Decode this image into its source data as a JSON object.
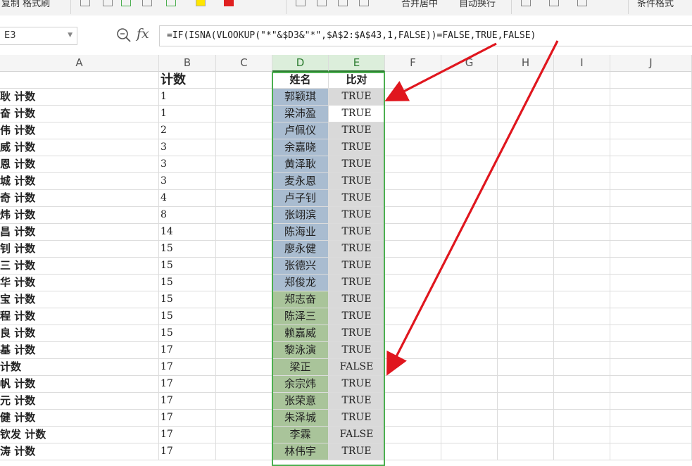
{
  "toolbar": {
    "items": [
      "复制 格式刷",
      "合并居中",
      "自动换行",
      "条件格式"
    ]
  },
  "formula_bar": {
    "name_box": "E3",
    "fx_label": "fx",
    "formula": "=IF(ISNA(VLOOKUP(\"*\"&$D3&\"*\",$A$2:$A$43,1,FALSE))=FALSE,TRUE,FALSE)"
  },
  "columns": [
    "A",
    "B",
    "C",
    "D",
    "E",
    "F",
    "G",
    "H",
    "I",
    "J"
  ],
  "header_row": {
    "b": "计数",
    "d": "姓名",
    "e": "比对"
  },
  "rows": [
    {
      "a": "耿 计数",
      "b": "1",
      "d": "郭颖琪",
      "e": "TRUE",
      "group": "blue"
    },
    {
      "a": "奋 计数",
      "b": "1",
      "d": "梁沛盈",
      "e": "TRUE",
      "group": "blue"
    },
    {
      "a": "伟 计数",
      "b": "2",
      "d": "卢佩仪",
      "e": "TRUE",
      "group": "blue"
    },
    {
      "a": "威 计数",
      "b": "3",
      "d": "余嘉晓",
      "e": "TRUE",
      "group": "blue"
    },
    {
      "a": "恩 计数",
      "b": "3",
      "d": "黄泽耿",
      "e": "TRUE",
      "group": "blue"
    },
    {
      "a": "城 计数",
      "b": "3",
      "d": "麦永恩",
      "e": "TRUE",
      "group": "blue"
    },
    {
      "a": "奇 计数",
      "b": "4",
      "d": "卢子钊",
      "e": "TRUE",
      "group": "blue"
    },
    {
      "a": "炜 计数",
      "b": "8",
      "d": "张翊滨",
      "e": "TRUE",
      "group": "blue"
    },
    {
      "a": "昌 计数",
      "b": "14",
      "d": "陈海业",
      "e": "TRUE",
      "group": "blue"
    },
    {
      "a": "钊 计数",
      "b": "15",
      "d": "廖永健",
      "e": "TRUE",
      "group": "blue"
    },
    {
      "a": "三 计数",
      "b": "15",
      "d": "张德兴",
      "e": "TRUE",
      "group": "blue"
    },
    {
      "a": "华 计数",
      "b": "15",
      "d": "郑俊龙",
      "e": "TRUE",
      "group": "blue"
    },
    {
      "a": "宝 计数",
      "b": "15",
      "d": "郑志奋",
      "e": "TRUE",
      "group": "green"
    },
    {
      "a": "程 计数",
      "b": "15",
      "d": "陈泽三",
      "e": "TRUE",
      "group": "green"
    },
    {
      "a": "良 计数",
      "b": "15",
      "d": "赖嘉威",
      "e": "TRUE",
      "group": "green"
    },
    {
      "a": "基 计数",
      "b": "17",
      "d": "黎泳演",
      "e": "TRUE",
      "group": "green"
    },
    {
      "a": " 计数",
      "b": "17",
      "d": "梁正",
      "e": "FALSE",
      "group": "green"
    },
    {
      "a": "帆 计数",
      "b": "17",
      "d": "余宗炜",
      "e": "TRUE",
      "group": "green"
    },
    {
      "a": "元 计数",
      "b": "17",
      "d": "张荣意",
      "e": "TRUE",
      "group": "green"
    },
    {
      "a": "健 计数",
      "b": "17",
      "d": "朱泽城",
      "e": "TRUE",
      "group": "green"
    },
    {
      "a": "钦发 计数",
      "b": "17",
      "d": "李霖",
      "e": "FALSE",
      "group": "green"
    },
    {
      "a": "涛 计数",
      "b": "17",
      "d": "林伟宇",
      "e": "TRUE",
      "group": "green"
    }
  ],
  "colors": {
    "blue_fill": "#a9bcd0",
    "green_fill": "#a9c49a",
    "grey_fill": "#d9d9d9",
    "selection": "#4caf50",
    "arrow": "#e0161e"
  }
}
